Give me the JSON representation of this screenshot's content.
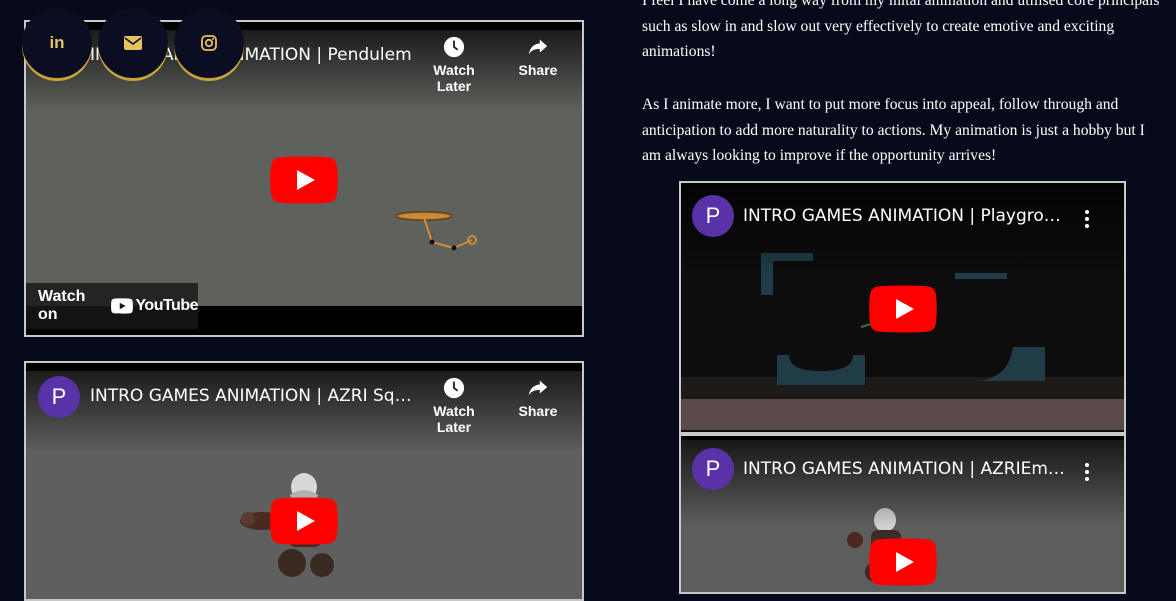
{
  "social": {
    "linkedin_label": "in"
  },
  "text": {
    "para1": "I feel I have come a long way from my inital animation and utilised core principals such as slow in and slow out very effectively to create emotive and exciting animations!",
    "para2": "As I animate more, I want to put more focus into appeal, follow through and anticipation to add more naturality to actions. My animation is just a hobby but I am always looking to improve if the opportunity arrives!"
  },
  "videos": [
    {
      "title": "INTRO GAMES ANIMATION | Pendulem",
      "channel_initial": "P",
      "watch_later": "Watch Later",
      "share": "Share",
      "watch_on": "Watch on",
      "youtube": "YouTube"
    },
    {
      "title": "INTRO GAMES ANIMATION | AZRI Squ...",
      "channel_initial": "P",
      "watch_later": "Watch Later",
      "share": "Share"
    },
    {
      "title": "INTRO GAMES ANIMATION | Playgrou...",
      "channel_initial": "P"
    },
    {
      "title": "INTRO GAMES ANIMATION | AZRIEmo...",
      "channel_initial": "P"
    }
  ],
  "colors": {
    "page_bg": "#070a1a",
    "accent_gold": "#c9a23c",
    "youtube_red": "#ff0000",
    "channel_purple": "#5a32a8"
  }
}
